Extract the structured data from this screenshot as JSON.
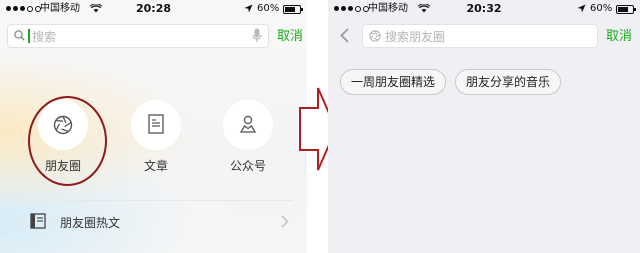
{
  "left": {
    "status": {
      "carrier": "中国移动",
      "time": "20:28",
      "battery": "60%"
    },
    "search": {
      "placeholder": "搜索",
      "cancel": "取消"
    },
    "categories": [
      {
        "label": "朋友圈",
        "icon": "aperture-icon"
      },
      {
        "label": "文章",
        "icon": "article-icon"
      },
      {
        "label": "公众号",
        "icon": "person-icon"
      }
    ],
    "hot_row": {
      "label": "朋友圈热文",
      "icon": "book-icon"
    }
  },
  "right": {
    "status": {
      "carrier": "中国移动",
      "time": "20:32",
      "battery": "60%"
    },
    "search": {
      "placeholder": "搜索朋友圈",
      "cancel": "取消"
    },
    "tags": [
      "一周朋友圈精选",
      "朋友分享的音乐"
    ]
  },
  "colors": {
    "accent": "#1aad19",
    "highlight": "#8e1a1e",
    "arrow": "#b11e24"
  }
}
